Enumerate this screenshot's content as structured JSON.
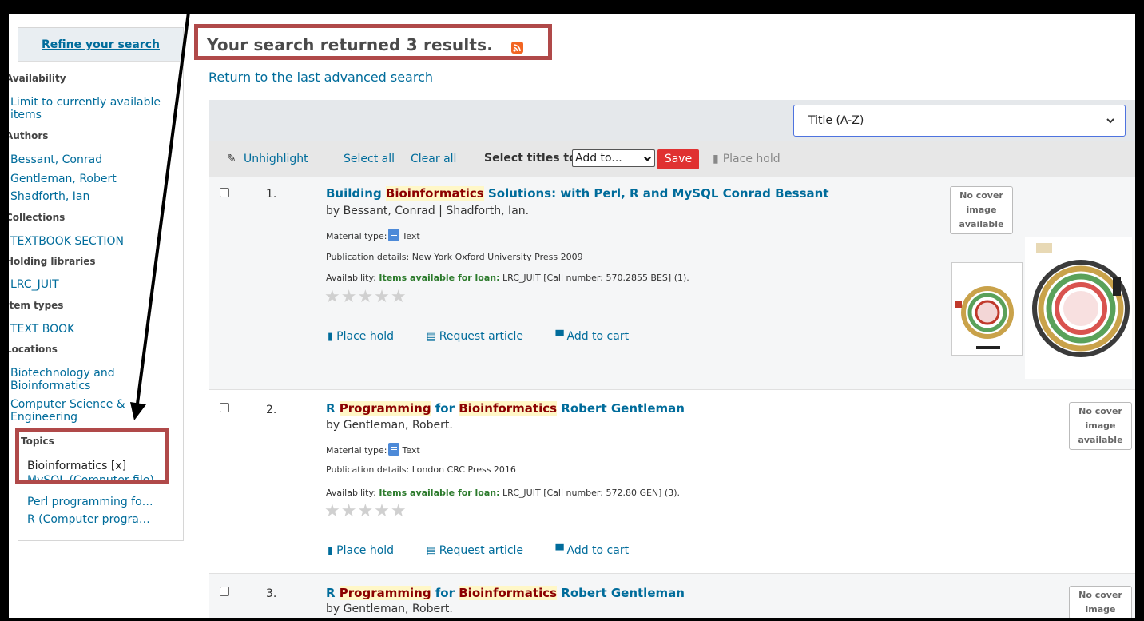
{
  "sidebar": {
    "refine_label": "Refine your search",
    "facets": [
      {
        "heading": "Availability",
        "items": [
          "Limit to currently available items"
        ]
      },
      {
        "heading": "Authors",
        "items": [
          "Bessant, Conrad",
          "Gentleman, Robert",
          "Shadforth, Ian"
        ]
      },
      {
        "heading": "Collections",
        "items": [
          "TEXTBOOK SECTION"
        ]
      },
      {
        "heading": "Holding libraries",
        "items": [
          "LRC_JUIT"
        ]
      },
      {
        "heading": "Item types",
        "items": [
          "TEXT BOOK"
        ]
      },
      {
        "heading": "Locations",
        "items": [
          "Biotechnology and Bioinformatics",
          "Computer Science & Engineering"
        ]
      },
      {
        "heading": "Topics",
        "items": [
          "Bioinformatics [x]",
          "MySQL (Computer file)",
          "Perl programming for...",
          "R (Computer program ..."
        ]
      }
    ]
  },
  "header": {
    "title": "Your search returned 3 results.",
    "return_link": "Return to the last advanced search"
  },
  "sort": {
    "selected": "Title (A-Z)"
  },
  "toolbar": {
    "unhighlight": "Unhighlight",
    "select_all": "Select all",
    "clear_all": "Clear all",
    "select_titles": "Select titles to:",
    "add_to": "Add to...",
    "save": "Save",
    "place_hold": "Place hold"
  },
  "labels": {
    "material_type": "Material type:",
    "material_text": "Text",
    "publication": "Publication details:",
    "availability": "Availability:",
    "items_available": "Items available for loan:",
    "place_hold": "Place hold",
    "request_article": "Request article",
    "add_to_cart": "Add to cart",
    "no_cover_1": "No cover",
    "no_cover_2": "image",
    "no_cover_3": "available",
    "stars": "★★★★★"
  },
  "results": [
    {
      "num": "1.",
      "title_pre": "Building ",
      "title_hl": "Bioinformatics",
      "title_post": " Solutions: with Perl, R and MySQL Conrad Bessant",
      "author": "by Bessant, Conrad | Shadforth, Ian.",
      "publication": "New York Oxford University Press 2009",
      "availability": "LRC_JUIT [Call number: 570.2855 BES] (1)."
    },
    {
      "num": "2.",
      "title_pre": "R ",
      "title_hl1": "Programming",
      "title_mid": " for ",
      "title_hl2": "Bioinformatics",
      "title_post": " Robert Gentleman",
      "author": "by Gentleman, Robert.",
      "publication": "London CRC Press 2016",
      "availability": "LRC_JUIT [Call number: 572.80 GEN] (3)."
    },
    {
      "num": "3.",
      "title_pre": "R ",
      "title_hl1": "Programming",
      "title_mid": " for ",
      "title_hl2": "Bioinformatics",
      "title_post": " Robert Gentleman",
      "author": "by Gentleman, Robert."
    }
  ],
  "colors": {
    "link": "#006c9b",
    "annotation": "#b04949",
    "save": "#e03131",
    "highlight": "#fff7c7"
  }
}
